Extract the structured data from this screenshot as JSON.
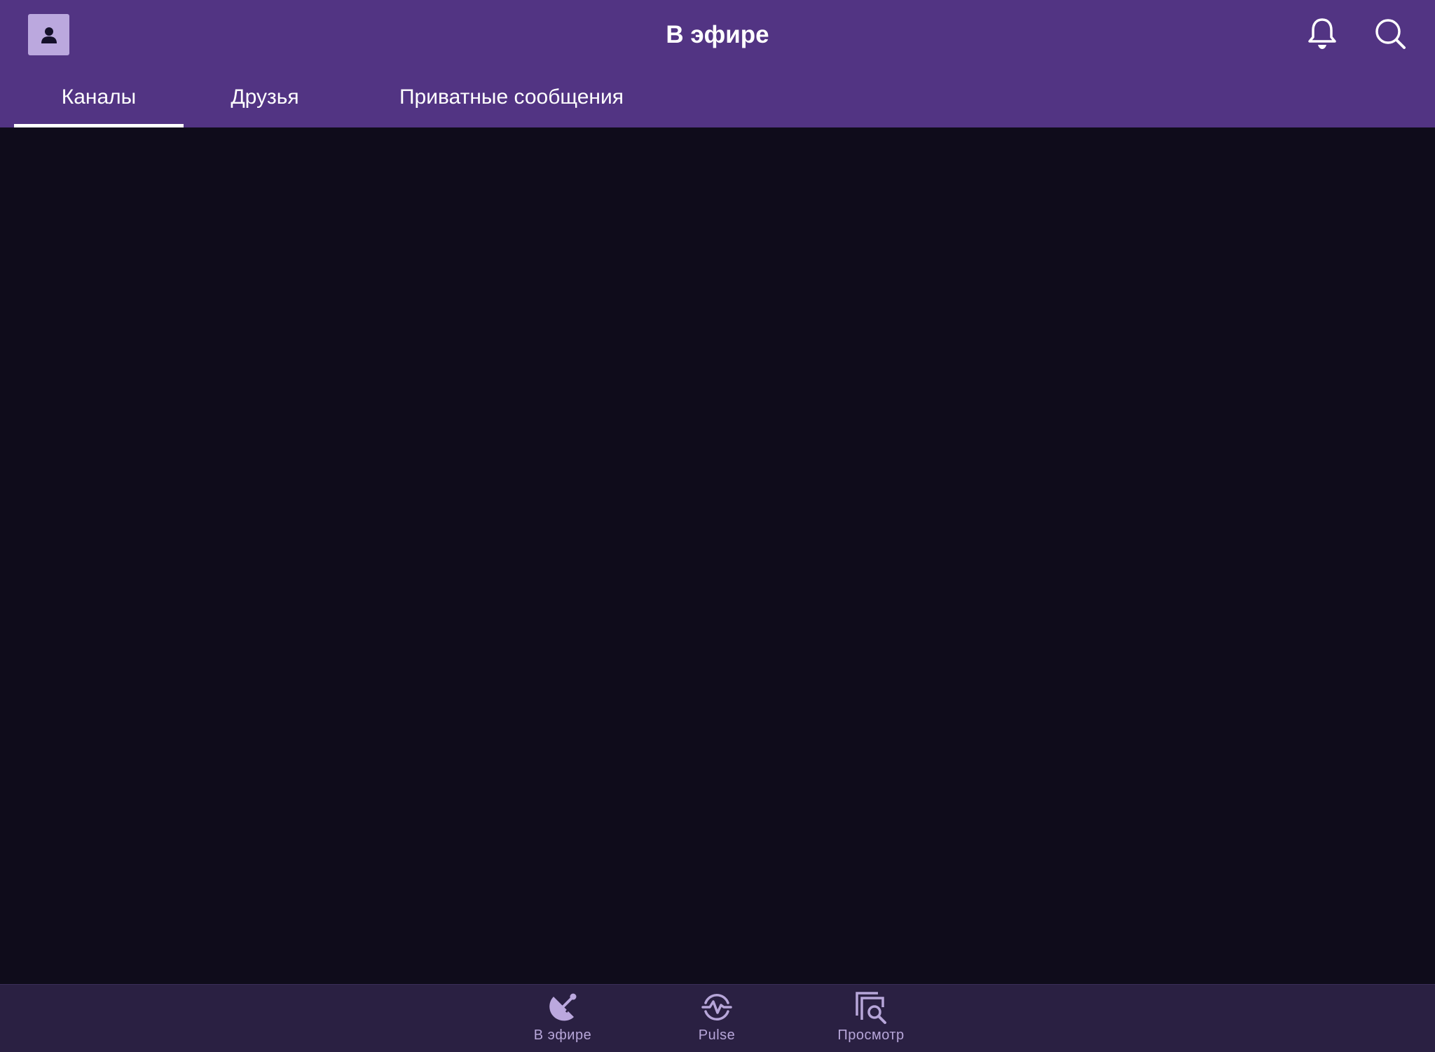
{
  "header": {
    "title": "В эфире",
    "avatar_icon": "user-icon",
    "notification_icon": "bell-icon",
    "search_icon": "search-icon"
  },
  "tabs": [
    {
      "label": "Каналы",
      "selected": true
    },
    {
      "label": "Друзья",
      "selected": false
    },
    {
      "label": "Приватные сообщения",
      "selected": false
    }
  ],
  "bottom_nav": [
    {
      "label": "В эфире",
      "icon": "satellite-dish-icon",
      "selected": true
    },
    {
      "label": "Pulse",
      "icon": "pulse-icon",
      "selected": false
    },
    {
      "label": "Просмотр",
      "icon": "browse-icon",
      "selected": false
    }
  ],
  "colors": {
    "header_bg": "#523483",
    "content_bg": "#0f0c1b",
    "bottom_nav_bg": "#2a2042",
    "accent_light": "#bba8de",
    "nav_label": "#b7a6d9"
  }
}
